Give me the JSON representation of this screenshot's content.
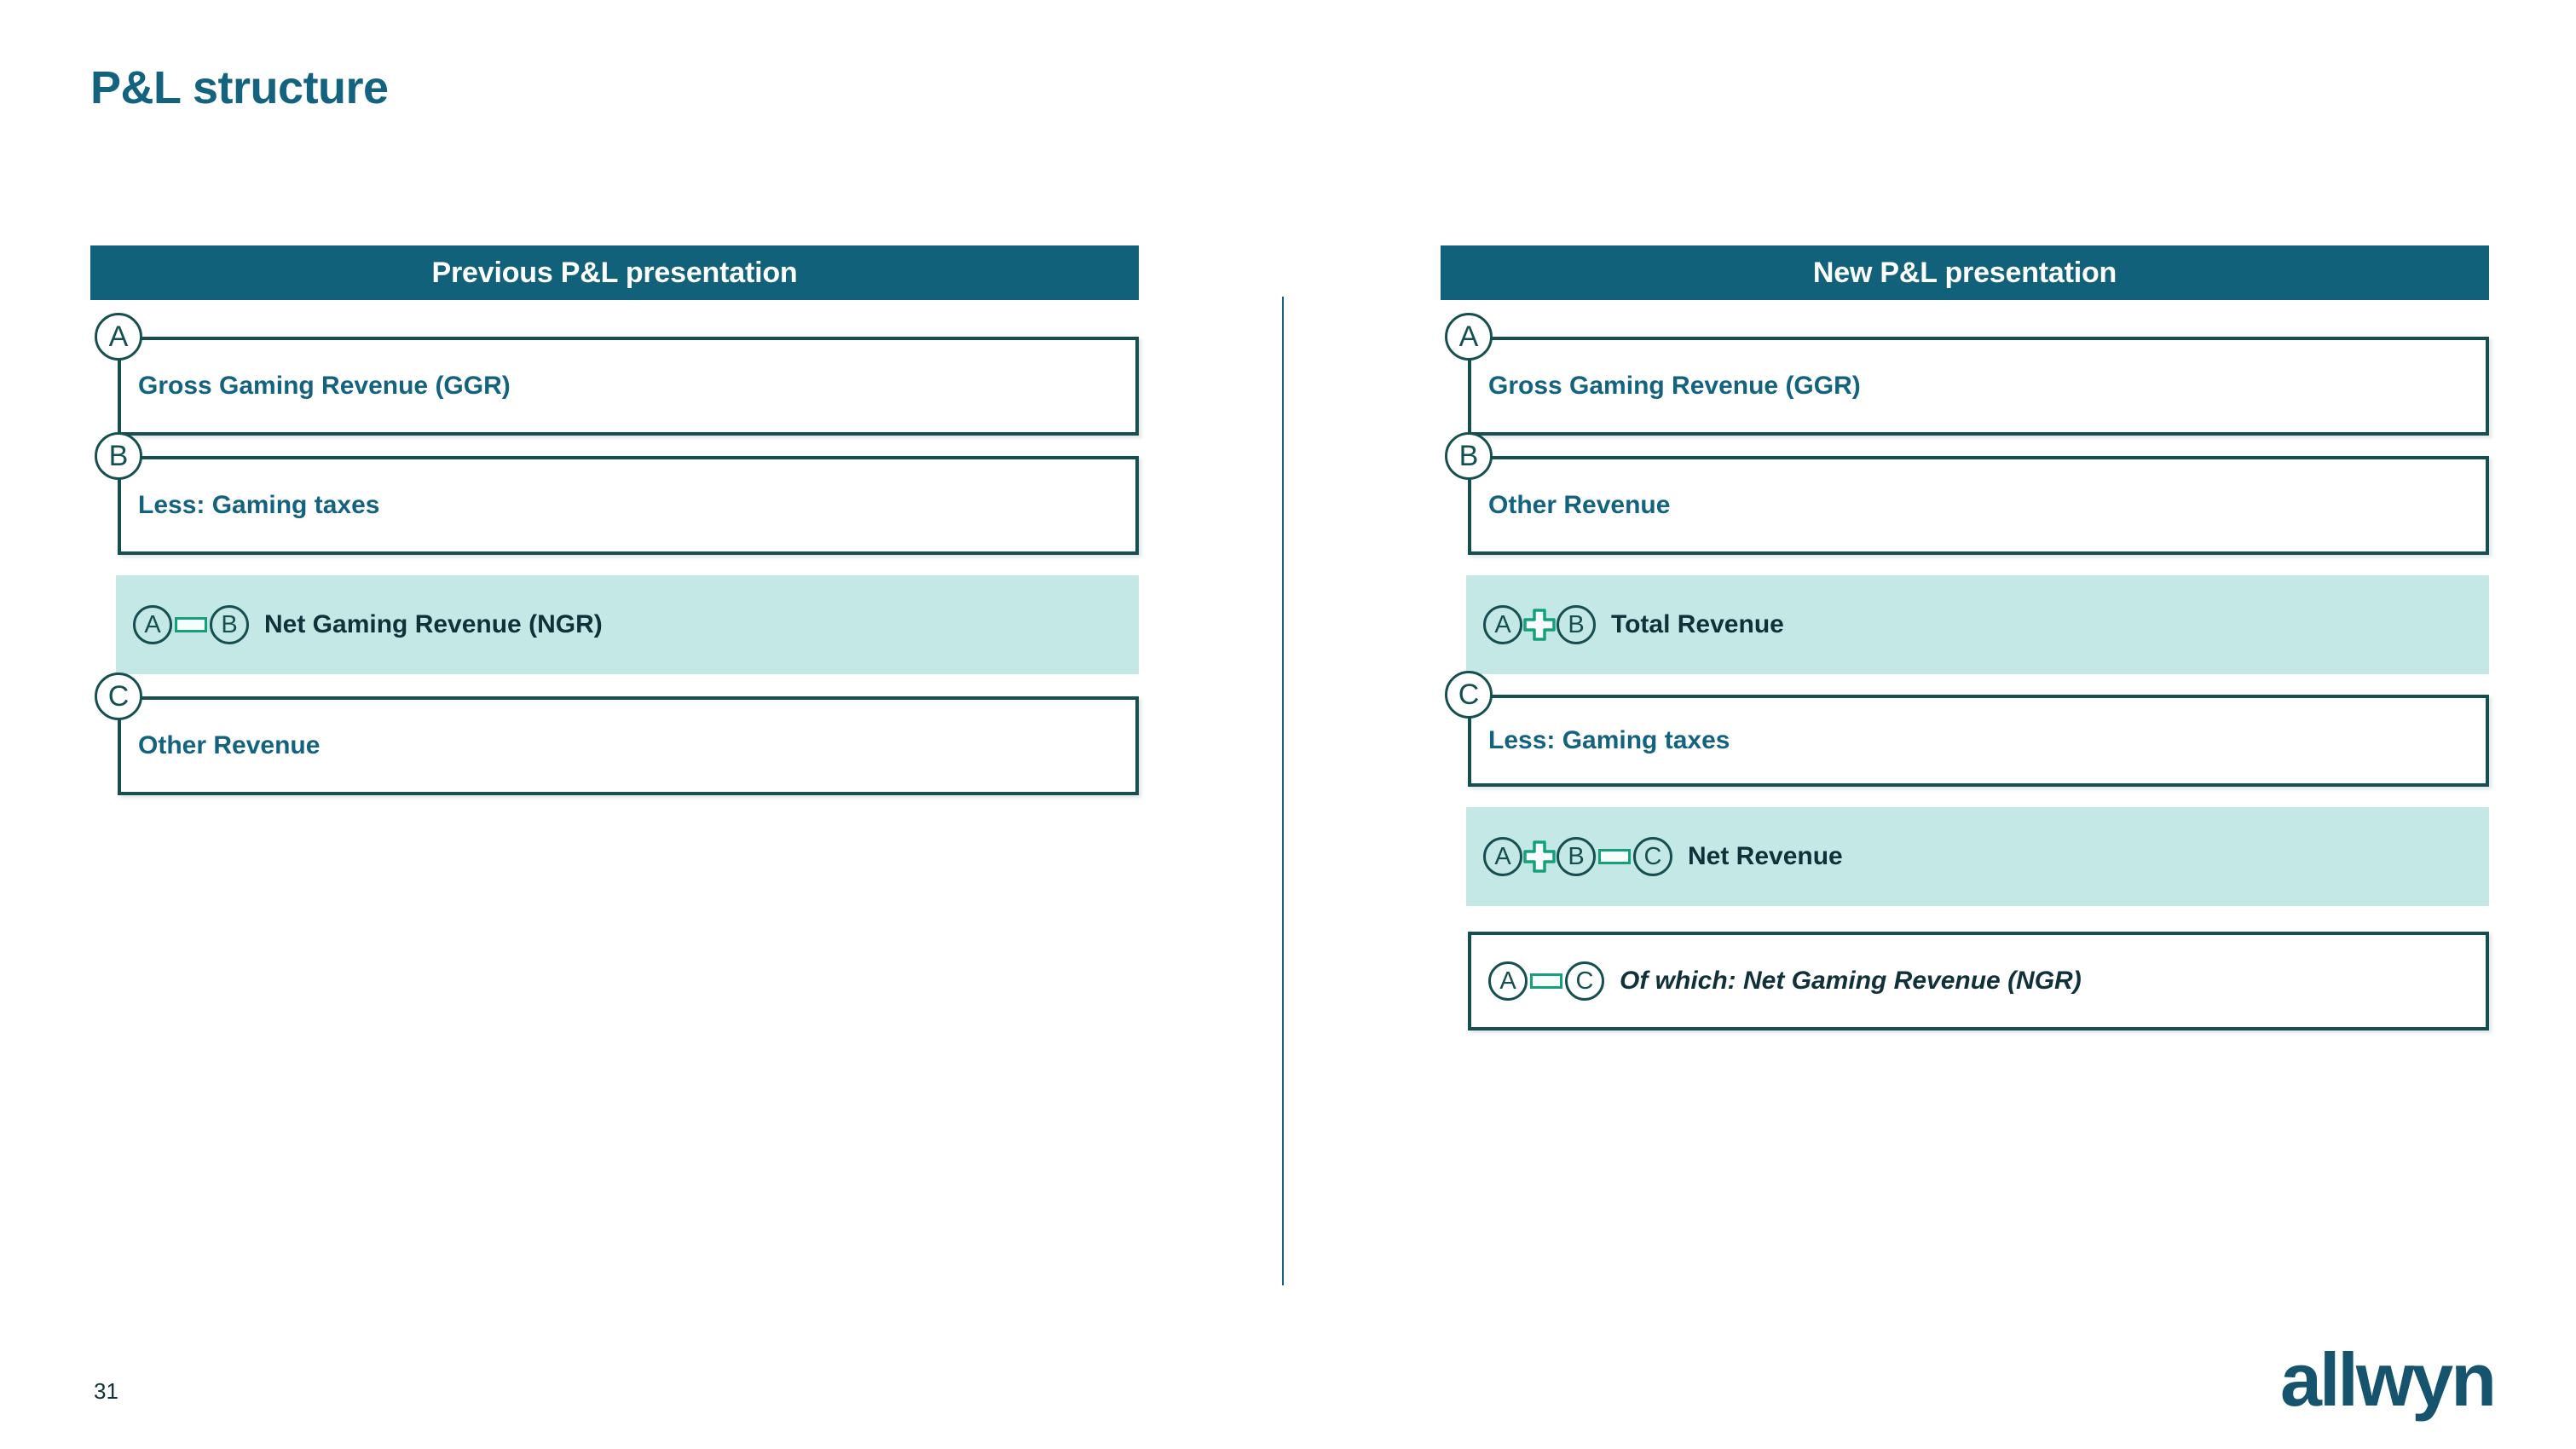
{
  "slide": {
    "title": "P&L structure",
    "page_number": "31",
    "brand": "allwyn",
    "colors": {
      "title_teal": "#136380",
      "header_bar": "#106179",
      "box_border": "#164f4f",
      "highlight_fill": "#c4e8e6",
      "operator_green": "#14a07a",
      "divider": "#16607c",
      "logo": "#16546e"
    }
  },
  "columns": [
    {
      "id": "previous",
      "header": "Previous P&L presentation",
      "rows": [
        {
          "corner_badge": "A",
          "label": "Gross Gaming Revenue (GGR)",
          "style": "plain",
          "height": 116,
          "italic": false,
          "formula": []
        },
        {
          "corner_badge": "B",
          "label": "Less: Gaming taxes",
          "style": "plain",
          "height": 116,
          "italic": false,
          "formula": []
        },
        {
          "corner_badge": null,
          "label": "Net Gaming Revenue (NGR)",
          "style": "highlight",
          "height": 116,
          "italic": false,
          "formula": [
            {
              "type": "badge",
              "value": "A"
            },
            {
              "type": "minus"
            },
            {
              "type": "badge",
              "value": "B"
            }
          ]
        },
        {
          "corner_badge": "C",
          "label": "Other Revenue",
          "style": "plain",
          "height": 116,
          "italic": false,
          "formula": []
        }
      ]
    },
    {
      "id": "new",
      "header": "New P&L presentation",
      "rows": [
        {
          "corner_badge": "A",
          "label": "Gross Gaming Revenue (GGR)",
          "style": "plain",
          "height": 116,
          "italic": false,
          "formula": []
        },
        {
          "corner_badge": "B",
          "label": "Other Revenue",
          "style": "plain",
          "height": 116,
          "italic": false,
          "formula": []
        },
        {
          "corner_badge": null,
          "label": "Total Revenue",
          "style": "highlight",
          "height": 116,
          "italic": false,
          "formula": [
            {
              "type": "badge",
              "value": "A"
            },
            {
              "type": "plus"
            },
            {
              "type": "badge",
              "value": "B"
            }
          ]
        },
        {
          "corner_badge": "C",
          "label": "Less: Gaming taxes",
          "style": "plain",
          "height": 108,
          "italic": false,
          "formula": []
        },
        {
          "corner_badge": null,
          "label": "Net Revenue",
          "style": "highlight",
          "height": 116,
          "italic": false,
          "formula": [
            {
              "type": "badge",
              "value": "A"
            },
            {
              "type": "plus"
            },
            {
              "type": "badge",
              "value": "B"
            },
            {
              "type": "minus"
            },
            {
              "type": "badge",
              "value": "C"
            }
          ]
        },
        {
          "corner_badge": null,
          "label": "Of which: Net Gaming Revenue (NGR)",
          "style": "plain",
          "height": 116,
          "italic": true,
          "formula": [
            {
              "type": "badge",
              "value": "A"
            },
            {
              "type": "minus"
            },
            {
              "type": "badge",
              "value": "C"
            }
          ]
        }
      ]
    }
  ]
}
